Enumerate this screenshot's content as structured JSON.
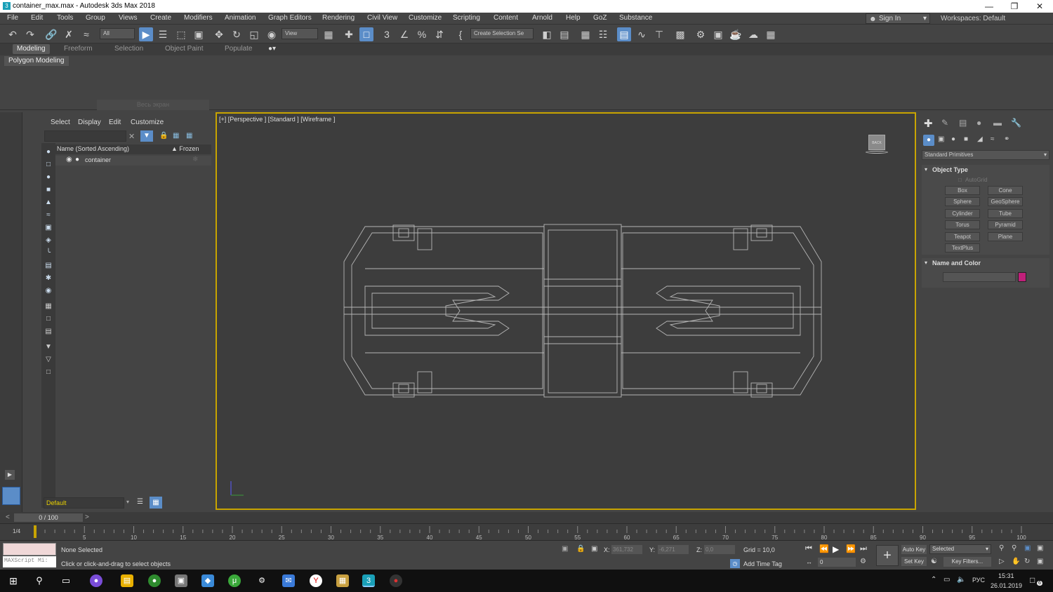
{
  "window": {
    "title": "container_max.max - Autodesk 3ds Max 2018",
    "app_icon": "3"
  },
  "menu": [
    "File",
    "Edit",
    "Tools",
    "Group",
    "Views",
    "Create",
    "Modifiers",
    "Animation",
    "Graph Editors",
    "Rendering",
    "Civil View",
    "Customize",
    "Scripting",
    "Content",
    "Arnold",
    "Help",
    "GoZ",
    "Substance"
  ],
  "account": {
    "sign_in": "Sign In",
    "workspaces_label": "Workspaces:",
    "workspace": "Default"
  },
  "toolbar": {
    "filter": "All",
    "ref_coord": "View",
    "named_selection": "Create Selection Se"
  },
  "ribbon": {
    "tabs": [
      "Modeling",
      "Freeform",
      "Selection",
      "Object Paint",
      "Populate"
    ],
    "active": "Modeling",
    "panel": "Polygon Modeling",
    "faded_label": "Весь экран"
  },
  "scene_explorer": {
    "menu": [
      "Select",
      "Display",
      "Edit",
      "Customize"
    ],
    "column_name": "Name (Sorted Ascending)",
    "column_frozen": "▲ Frozen",
    "item": "container",
    "layer": "Default"
  },
  "viewport": {
    "label": "[+] [Perspective ] [Standard ] [Wireframe ]",
    "viewcube_face": "BACK"
  },
  "command_panel": {
    "category": "Standard Primitives",
    "rollout_object_type": "Object Type",
    "autogrid": "AutoGrid",
    "buttons": [
      "Box",
      "Cone",
      "Sphere",
      "GeoSphere",
      "Cylinder",
      "Tube",
      "Torus",
      "Pyramid",
      "Teapot",
      "Plane",
      "TextPlus"
    ],
    "rollout_name_color": "Name and Color",
    "object_color": "#c0207a"
  },
  "time": {
    "frame_counter": "0 / 100",
    "ticks": [
      "5",
      "10",
      "15",
      "20",
      "25",
      "30",
      "35",
      "40",
      "45",
      "50",
      "55",
      "60",
      "65",
      "70",
      "75",
      "80",
      "85",
      "90",
      "95",
      "100"
    ],
    "time_config_icon": "1/4"
  },
  "status": {
    "maxscript": "MAXScript Mi:",
    "selection": "None Selected",
    "prompt": "Click or click-and-drag to select objects",
    "x_label": "X:",
    "x": "361,732",
    "y_label": "Y:",
    "y": "-6,271",
    "z_label": "Z:",
    "z": "0,0",
    "grid": "Grid = 10,0",
    "add_time_tag": "Add Time Tag",
    "auto_key": "Auto Key",
    "set_key": "Set Key",
    "selected_dd": "Selected",
    "key_filters": "Key Filters...",
    "frame": "0"
  },
  "taskbar": {
    "lang": "РУС",
    "time": "15:31",
    "date": "26.01.2019",
    "notif": "6"
  }
}
